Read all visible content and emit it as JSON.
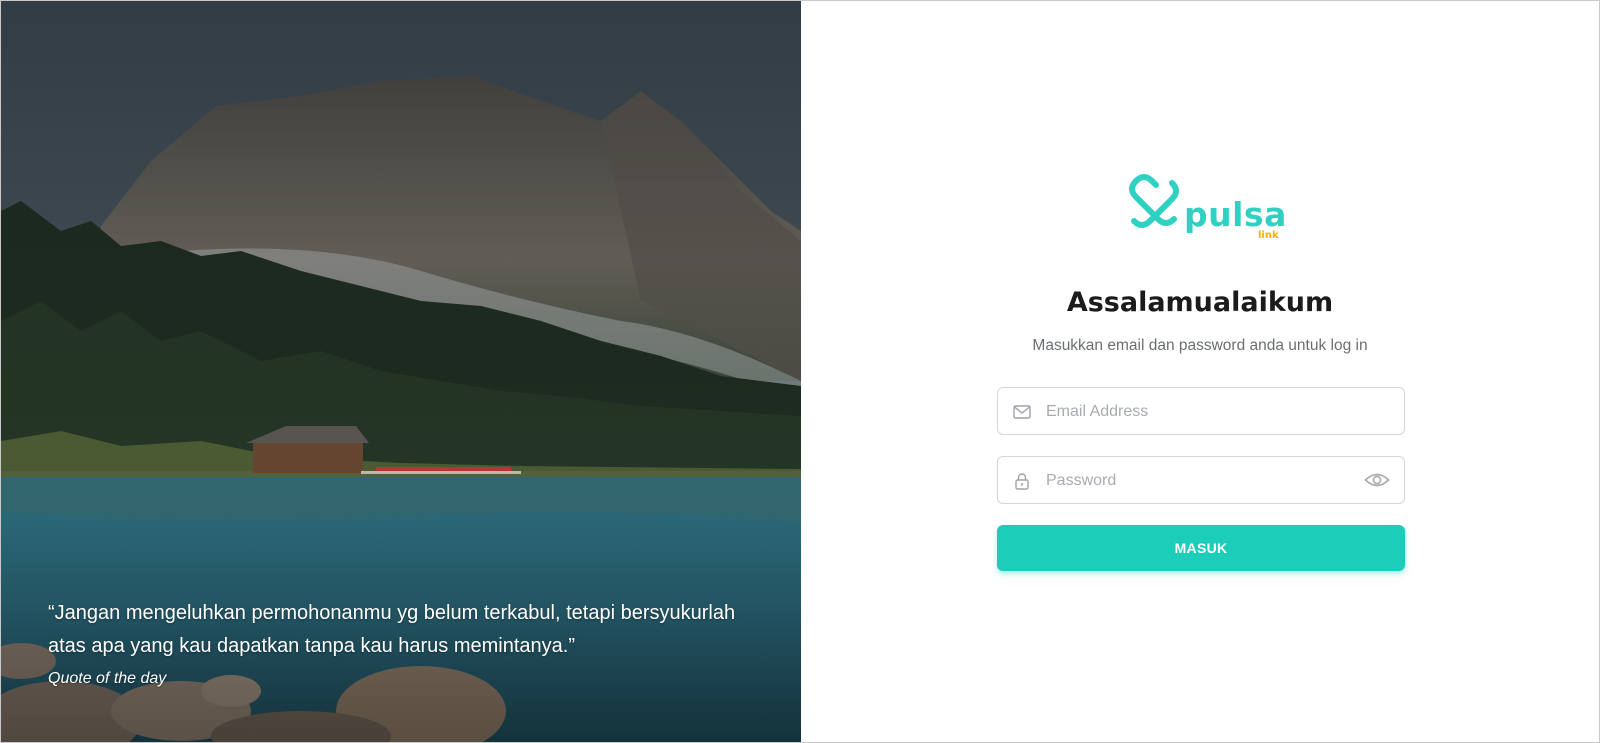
{
  "hero": {
    "quote": "“Jangan mengeluhkan permohonanmu yg belum terkabul, tetapi bersyukurlah atas apa yang kau dapatkan tanpa kau harus memintanya.”",
    "caption": "Quote of the day"
  },
  "brand": {
    "name": "pulsa",
    "sub": "link",
    "primary_color": "#2fd1c3",
    "secondary_color": "#f4b400"
  },
  "login": {
    "greeting": "Assalamualaikum",
    "subtitle": "Masukkan email dan password anda untuk log in",
    "email": {
      "placeholder": "Email Address",
      "value": "",
      "icon": "mail-icon"
    },
    "password": {
      "placeholder": "Password",
      "value": "",
      "icon": "lock-icon",
      "toggle_icon": "eye-icon"
    },
    "submit_label": "MASUK",
    "button_color": "#1ccdb9"
  }
}
